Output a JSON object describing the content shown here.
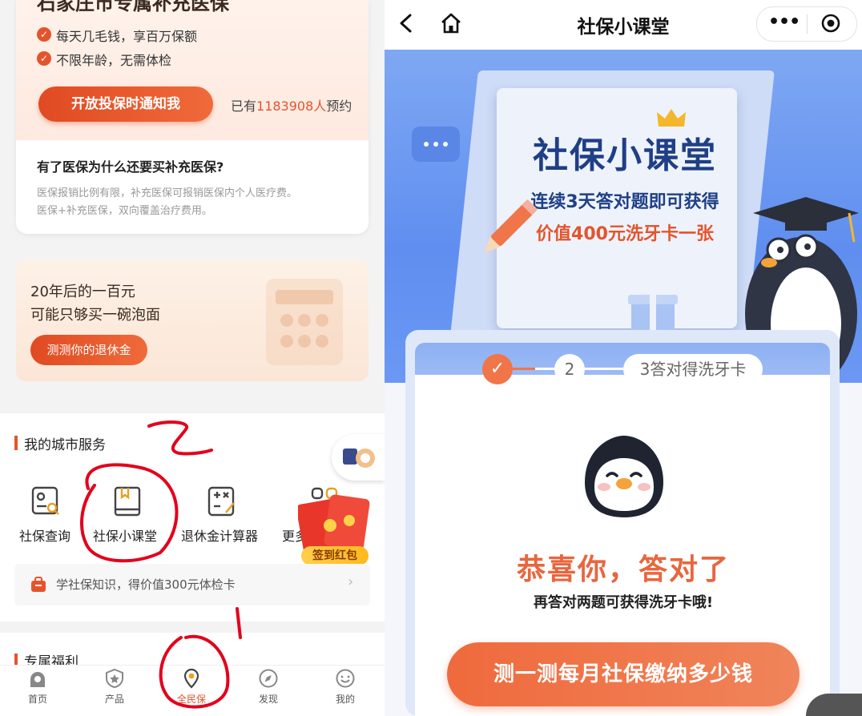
{
  "left": {
    "card1": {
      "title": "石家庄市专属补充医保",
      "bullets": [
        "每天几毛钱，享百万保额",
        "不限年龄，无需体检"
      ],
      "notify_button": "开放投保时通知我",
      "reserve_prefix": "已有",
      "reserve_count": "1183908人",
      "reserve_suffix": "预约",
      "question": "有了医保为什么还要买补充医保?",
      "answer_lines": [
        "医保报销比例有限，补充医保可报销医保内个人医疗费。",
        "医保+补充医保，双向覆盖治疗费用。"
      ]
    },
    "card2": {
      "line1": "20年后的一百元",
      "line2": "可能只够买一碗泡面",
      "button": "测测你的退休金"
    },
    "city_services": {
      "title": "我的城市服务",
      "items": [
        {
          "label": "社保查询",
          "icon": "search-card-icon"
        },
        {
          "label": "社保小课堂",
          "icon": "book-icon"
        },
        {
          "label": "退休金计算器",
          "icon": "calculator-icon"
        },
        {
          "label": "更多",
          "icon": "more-icon"
        }
      ],
      "redpack_label": "签到红包",
      "tip": "学社保知识，得价值300元体检卡"
    },
    "section2_title": "专属福利",
    "tabs": [
      {
        "label": "首页",
        "icon": "home-icon"
      },
      {
        "label": "产品",
        "icon": "shield-star-icon"
      },
      {
        "label": "全民保",
        "icon": "location-pin-icon",
        "active": true
      },
      {
        "label": "发现",
        "icon": "compass-icon"
      },
      {
        "label": "我的",
        "icon": "smile-icon"
      }
    ],
    "annotation_number": "2"
  },
  "right": {
    "nav": {
      "title": "社保小课堂",
      "more": "•••"
    },
    "banner": {
      "title": "社保小课堂",
      "sub1": "连续3天答对题即可获得",
      "sub2": "价值400元洗牙卡一张"
    },
    "steps": {
      "step1": "✓",
      "step2": "2",
      "step3": "3答对得洗牙卡"
    },
    "congrats": "恭喜你，答对了",
    "congrats_sub": "再答对两题可获得洗牙卡哦!",
    "test_button": "测一测每月社保缴纳多少钱"
  },
  "colors": {
    "accent": "#e4542c",
    "banner_blue": "#6b98f4",
    "title_navy": "#1f3f86"
  }
}
